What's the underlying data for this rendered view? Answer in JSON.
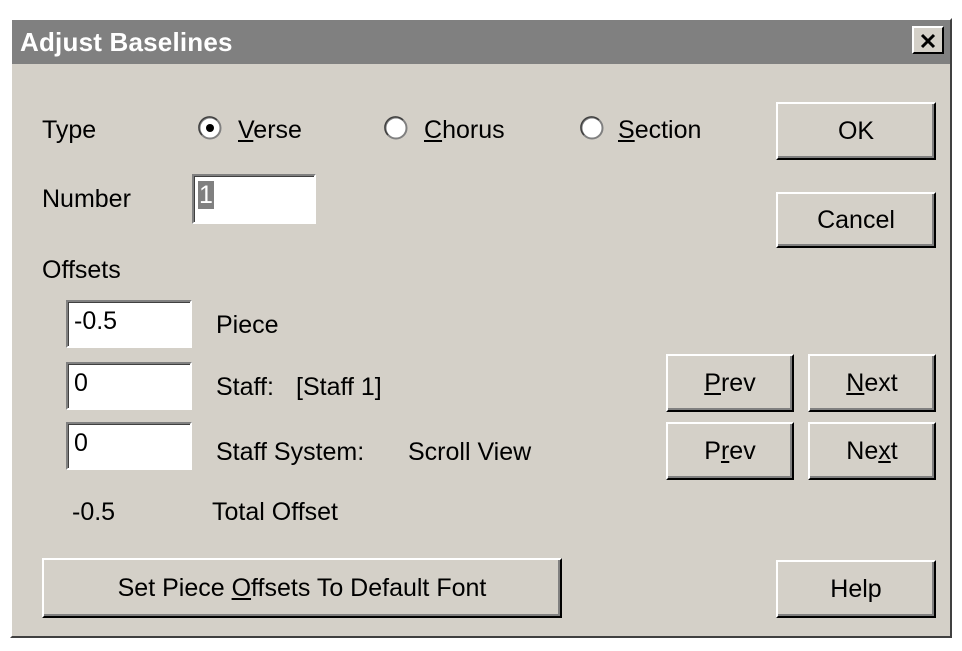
{
  "window": {
    "title": "Adjust Baselines",
    "close_glyph": "✕"
  },
  "type_group": {
    "label": "Type",
    "options": [
      {
        "pre": "",
        "mnemonic": "V",
        "post": "erse",
        "selected": true
      },
      {
        "pre": "",
        "mnemonic": "C",
        "post": "horus",
        "selected": false
      },
      {
        "pre": "",
        "mnemonic": "S",
        "post": "ection",
        "selected": false
      }
    ]
  },
  "number": {
    "label": "Number",
    "value": "1"
  },
  "offsets": {
    "label": "Offsets",
    "piece_value": "-0.5",
    "piece_label": "Piece",
    "staff_value": "0",
    "staff_label": "Staff:",
    "staff_name": "[Staff 1]",
    "system_value": "0",
    "system_label": "Staff System:",
    "system_name": "Scroll View",
    "total_value": "-0.5",
    "total_label": "Total Offset"
  },
  "buttons": {
    "ok": "OK",
    "cancel": "Cancel",
    "prev1": {
      "pre": "",
      "mnemonic": "P",
      "post": "rev"
    },
    "next1": {
      "pre": "",
      "mnemonic": "N",
      "post": "ext"
    },
    "prev2": {
      "pre": "P",
      "mnemonic": "r",
      "post": "ev"
    },
    "next2": {
      "pre": "Ne",
      "mnemonic": "x",
      "post": "t"
    },
    "set_default": {
      "pre": "Set Piece ",
      "mnemonic": "O",
      "post": "ffsets To Default Font"
    },
    "help": "Help"
  },
  "colors": {
    "face": "#d4d0c8",
    "titlebar": "#808080",
    "selection": "#808080"
  }
}
